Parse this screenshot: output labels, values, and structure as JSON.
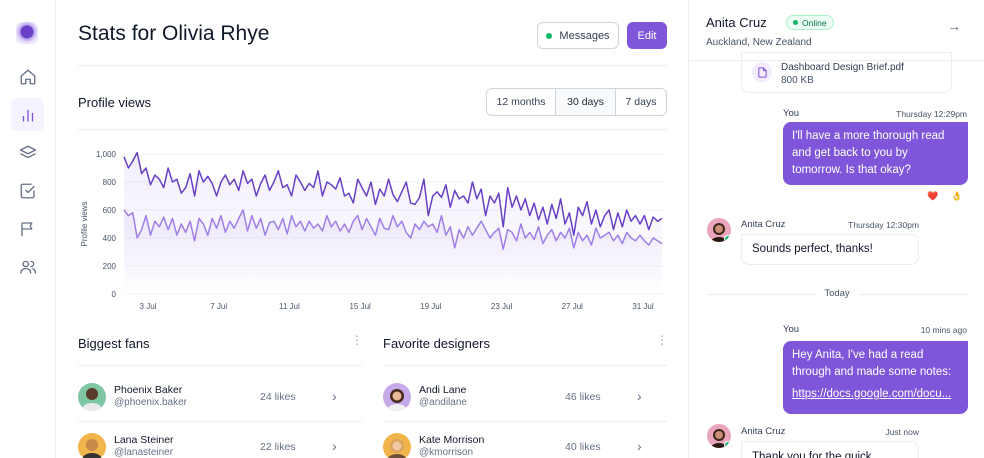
{
  "page": {
    "title": "Stats for Olivia Rhye"
  },
  "header": {
    "messages_label": "Messages",
    "edit_label": "Edit"
  },
  "sidebar": {
    "items": [
      {
        "icon": "home-icon"
      },
      {
        "icon": "bar-chart-icon",
        "active": true
      },
      {
        "icon": "layers-icon"
      },
      {
        "icon": "check-square-icon"
      },
      {
        "icon": "flag-icon"
      },
      {
        "icon": "users-icon"
      }
    ]
  },
  "profile_views": {
    "title": "Profile views",
    "ranges": [
      {
        "label": "12 months",
        "selected": false
      },
      {
        "label": "30 days",
        "selected": true
      },
      {
        "label": "7 days",
        "selected": false
      }
    ]
  },
  "chart_data": {
    "type": "line",
    "title": "",
    "xlabel": "",
    "ylabel": "Profile views",
    "ylim": [
      0,
      1000
    ],
    "yticks": [
      "0",
      "200",
      "400",
      "600",
      "800",
      "1,000"
    ],
    "xticks": [
      "3 Jul",
      "7 Jul",
      "11 Jul",
      "15 Jul",
      "19 Jul",
      "23 Jul",
      "27 Jul",
      "31 Jul"
    ],
    "grid": true,
    "series": [
      {
        "color": "#6941c6",
        "values": [
          980,
          900,
          950,
          1010,
          860,
          900,
          780,
          850,
          820,
          760,
          900,
          800,
          820,
          720,
          760,
          860,
          700,
          880,
          800,
          840,
          790,
          700,
          800,
          850,
          780,
          820,
          740,
          880,
          790,
          820,
          700,
          790,
          850,
          740,
          800,
          880,
          760,
          780,
          700,
          850,
          800,
          740,
          790,
          760,
          880,
          700,
          800,
          780,
          750,
          830,
          700,
          720,
          650,
          820,
          760,
          700,
          800,
          640,
          750,
          700,
          820,
          710,
          660,
          730,
          800,
          650,
          640,
          690,
          820,
          560,
          700,
          730,
          690,
          780,
          620,
          740,
          680,
          700,
          650,
          800,
          680,
          750,
          560,
          700,
          650,
          720,
          480,
          760,
          620,
          700,
          600,
          680,
          560,
          650,
          530,
          620,
          500,
          640,
          540,
          680,
          500,
          580,
          420,
          620,
          560,
          660,
          500,
          600,
          480,
          560,
          600,
          460,
          580,
          480,
          600,
          520,
          560,
          500,
          560,
          460,
          550,
          520,
          540
        ]
      },
      {
        "color": "#a07ee8",
        "values": [
          600,
          560,
          580,
          400,
          460,
          560,
          420,
          520,
          480,
          550,
          460,
          540,
          420,
          500,
          440,
          520,
          380,
          540,
          500,
          420,
          540,
          470,
          560,
          440,
          520,
          470,
          540,
          600,
          450,
          560,
          470,
          540,
          420,
          510,
          520,
          460,
          540,
          430,
          560,
          480,
          520,
          450,
          520,
          470,
          500,
          450,
          560,
          480,
          520,
          450,
          500,
          440,
          520,
          560,
          460,
          540,
          480,
          420,
          540,
          470,
          460,
          560,
          480,
          520,
          440,
          400,
          500,
          460,
          520,
          480,
          500,
          440,
          560,
          420,
          480,
          330,
          460,
          400,
          480,
          420,
          470,
          520,
          460,
          400,
          440,
          470,
          320,
          460,
          440,
          380,
          500,
          400,
          440,
          390,
          480,
          360,
          420,
          460,
          380,
          440,
          400,
          470,
          330,
          440,
          380,
          420,
          350,
          470,
          400,
          420,
          440,
          380,
          420,
          360,
          440,
          400,
          380,
          420,
          380,
          350,
          400,
          380,
          360
        ]
      }
    ]
  },
  "fans": {
    "title": "Biggest fans",
    "people": [
      {
        "name": "Phoenix Baker",
        "handle": "@phoenix.baker",
        "likes": "24 likes"
      },
      {
        "name": "Lana Steiner",
        "handle": "@lanasteiner",
        "likes": "22 likes"
      }
    ]
  },
  "designers": {
    "title": "Favorite designers",
    "people": [
      {
        "name": "Andi Lane",
        "handle": "@andilane",
        "likes": "46 likes"
      },
      {
        "name": "Kate Morrison",
        "handle": "@kmorrison",
        "likes": "40 likes"
      }
    ]
  },
  "chat": {
    "name": "Anita Cruz",
    "status": "Online",
    "location": "Auckland, New Zealand",
    "file": {
      "name": "Dashboard Design Brief.pdf",
      "size": "800 KB"
    },
    "messages": [
      {
        "from": "You",
        "time": "Thursday 12:29pm",
        "text": "I'll have a more thorough read and get back to you by tomorrow. Is that okay?",
        "reactions": [
          "❤️",
          "👌"
        ]
      },
      {
        "from": "Anita Cruz",
        "time": "Thursday 12:30pm",
        "text": "Sounds perfect, thanks!"
      },
      {
        "from": "You",
        "time": "10 mins ago",
        "text": "Hey Anita, I've had a read through and made some notes:",
        "link": "https://docs.google.com/docu..."
      },
      {
        "from": "Anita Cruz",
        "time": "Just now",
        "text": "Thank you for the quick..."
      }
    ],
    "divider": "Today"
  },
  "colors": {
    "accent": "#7f56d9",
    "online": "#12b76a"
  }
}
